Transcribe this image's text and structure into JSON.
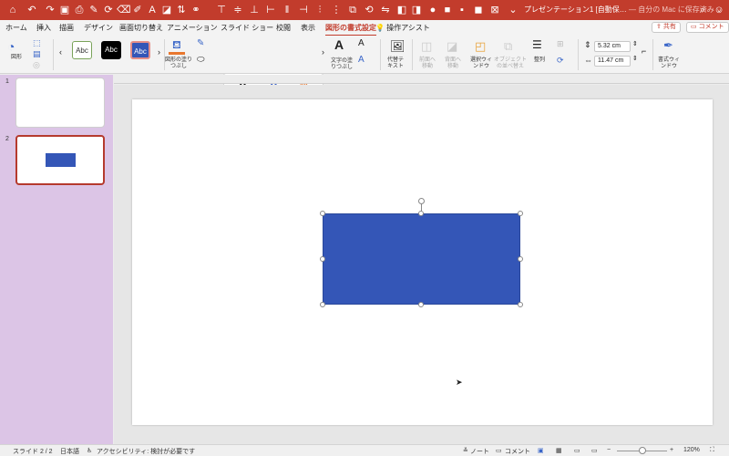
{
  "window": {
    "title": "プレゼンテーション1 [自動保…",
    "save_status": "— 自分の Mac に保存済み ⌄"
  },
  "ribbon_tabs": [
    "ホーム",
    "挿入",
    "描画",
    "デザイン",
    "画面切り替え",
    "アニメーション",
    "スライド ショー",
    "校閲",
    "表示",
    "図形の書式設定",
    "操作アシスト"
  ],
  "share": {
    "share_label": "共有",
    "comment_label": "コメント"
  },
  "ribbon": {
    "shapes_label": "図形",
    "style_samples": [
      "Abc",
      "Abc",
      "Abc"
    ],
    "fill_label": "図形の塗りつぶし",
    "wordart_samples": [
      "A",
      "A",
      "A"
    ],
    "text_fill_label": "文字の塗りつぶし",
    "alt_text_label": "代替テキスト",
    "bring_forward_label": "前面へ移動",
    "send_backward_label": "背面へ移動",
    "selection_pane_label": "選択ウィンドウ",
    "align_objects_label": "オブジェクトの並べ替え",
    "arrange_label": "整列",
    "height_value": "5.32 cm",
    "width_value": "11.47 cm",
    "format_pane_label": "書式ウィンドウ"
  },
  "slides": [
    {
      "number": "1"
    },
    {
      "number": "2"
    }
  ],
  "statusbar": {
    "slide_position": "スライド 2 / 2",
    "language": "日本語",
    "accessibility": "アクセシビリティ: 検討が必要です",
    "notes_label": "ノート",
    "comments_label": "コメント",
    "zoom": "120%"
  },
  "colors": {
    "titlebar": "#c23c2c",
    "shape_fill": "#3456b7",
    "thumbnail_pane": "#dcc5e6"
  }
}
